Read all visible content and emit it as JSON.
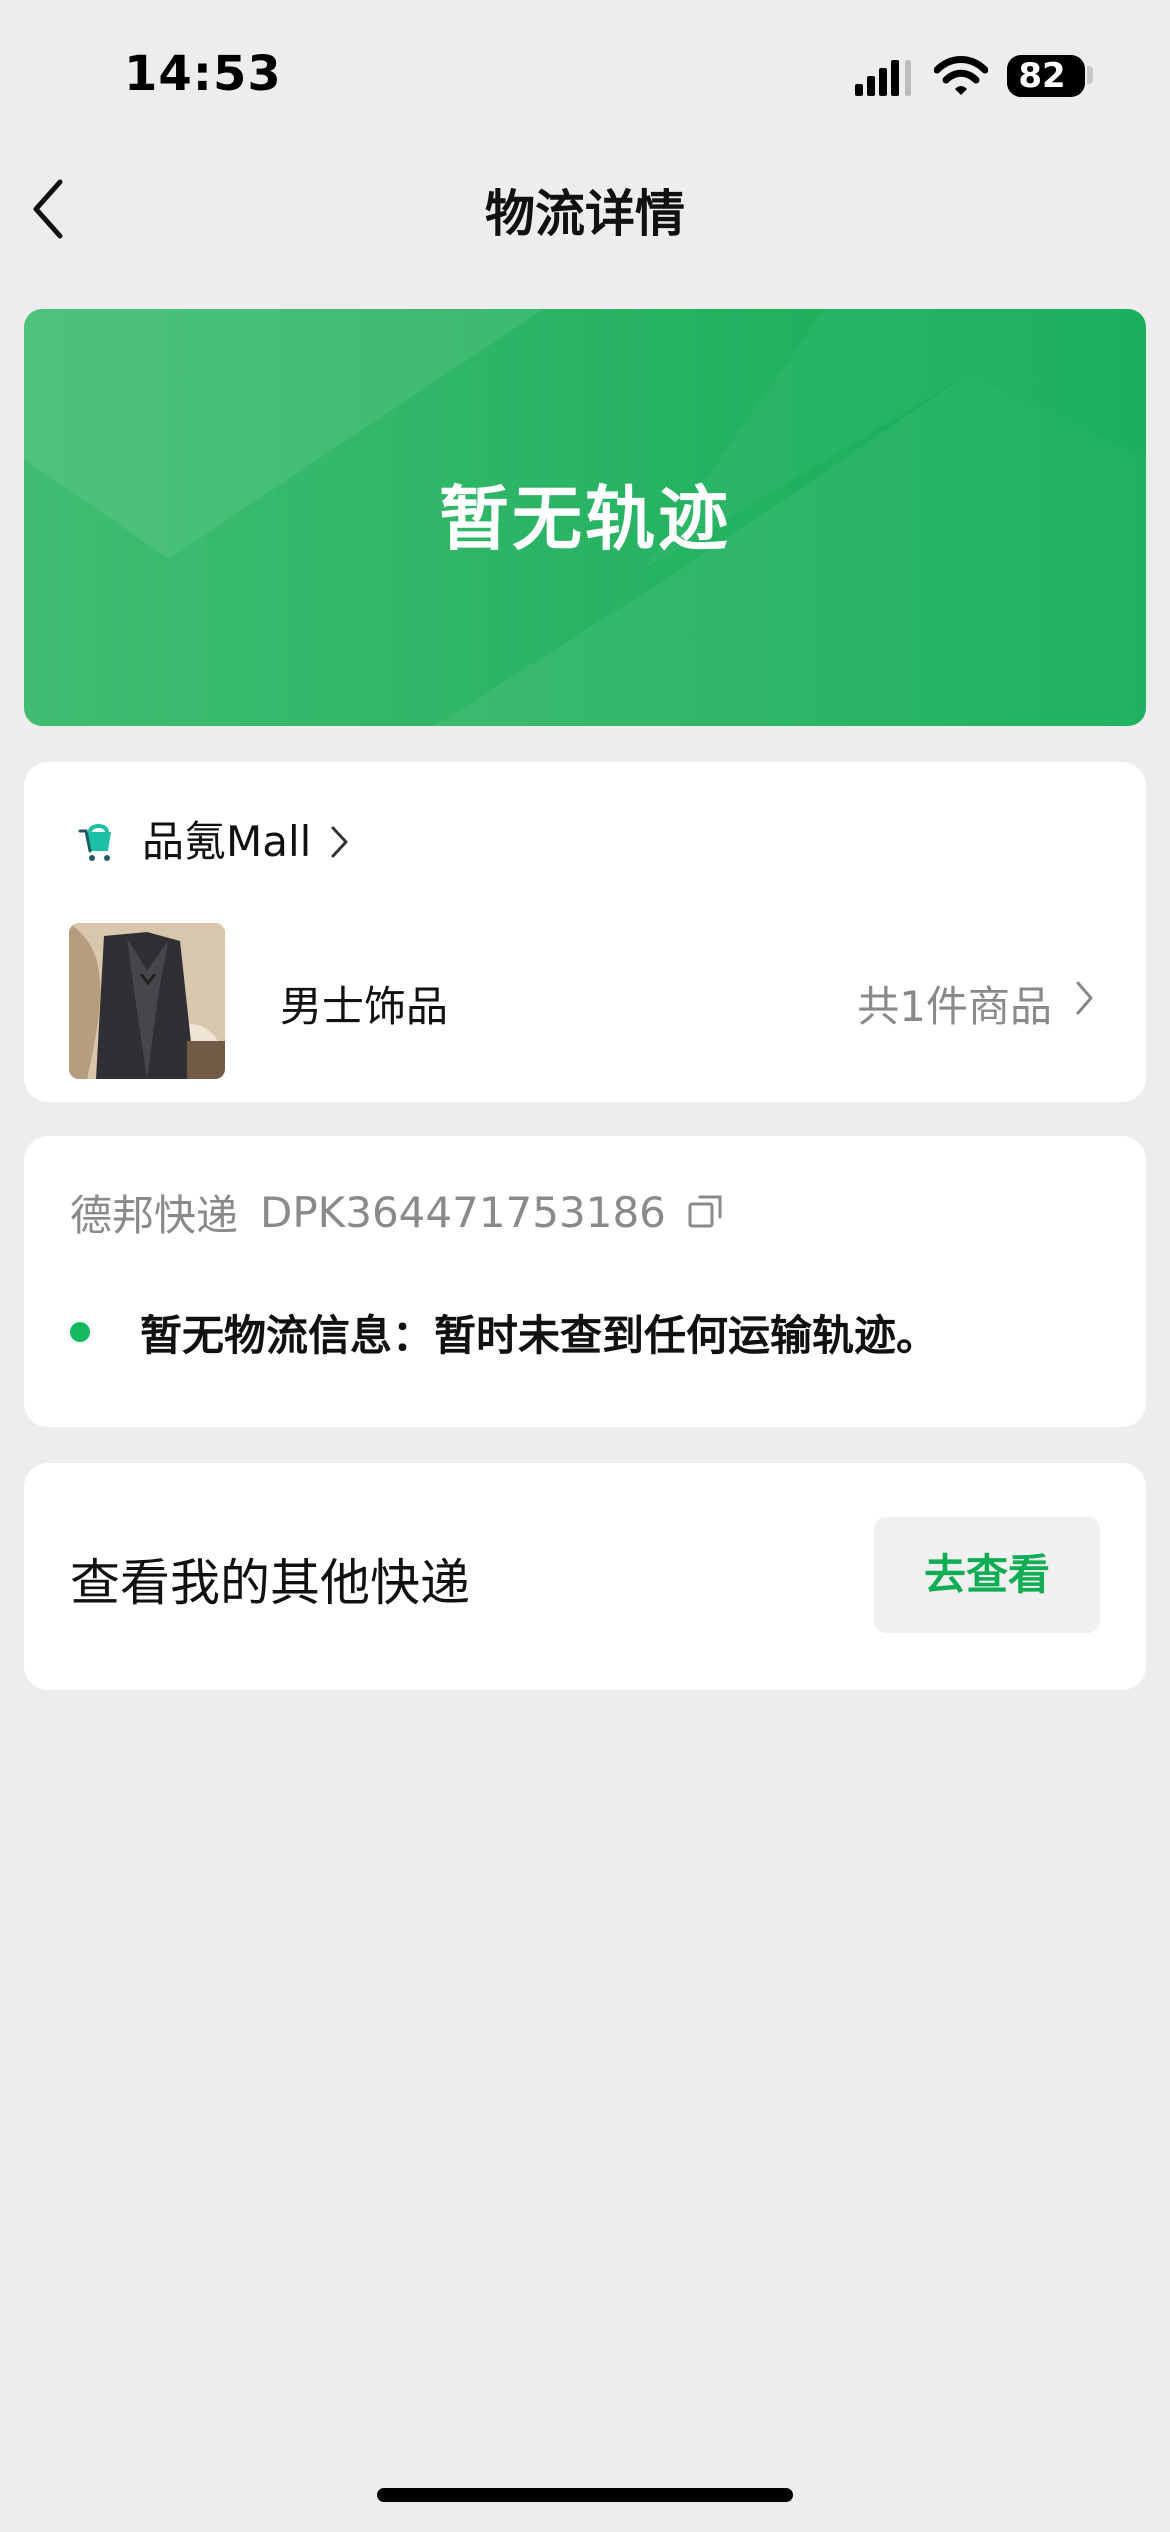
{
  "status_bar": {
    "time": "14:53",
    "battery": "82",
    "signal_icon": "signal-icon",
    "wifi_icon": "wifi-icon",
    "battery_icon": "battery-icon"
  },
  "nav": {
    "title": "物流详情",
    "back_icon": "chevron-left-icon"
  },
  "hero": {
    "title": "暂无轨迹"
  },
  "shop": {
    "name": "品氪Mall",
    "product_name": "男士饰品",
    "product_count": "共1件商品",
    "shop_icon": "shopping-cart-icon",
    "chevron_icon": "chevron-right-icon"
  },
  "tracking": {
    "courier": "德邦快递",
    "tracking_number": "DPK364471753186",
    "copy_icon": "copy-icon",
    "status": "暂无物流信息：暂时未查到任何运输轨迹。"
  },
  "other": {
    "text": "查看我的其他快递",
    "button_label": "去查看"
  },
  "colors": {
    "accent": "#12AD58",
    "background": "#EDEDED",
    "card": "#FFFFFF",
    "secondary_text": "#8A8A8A"
  }
}
